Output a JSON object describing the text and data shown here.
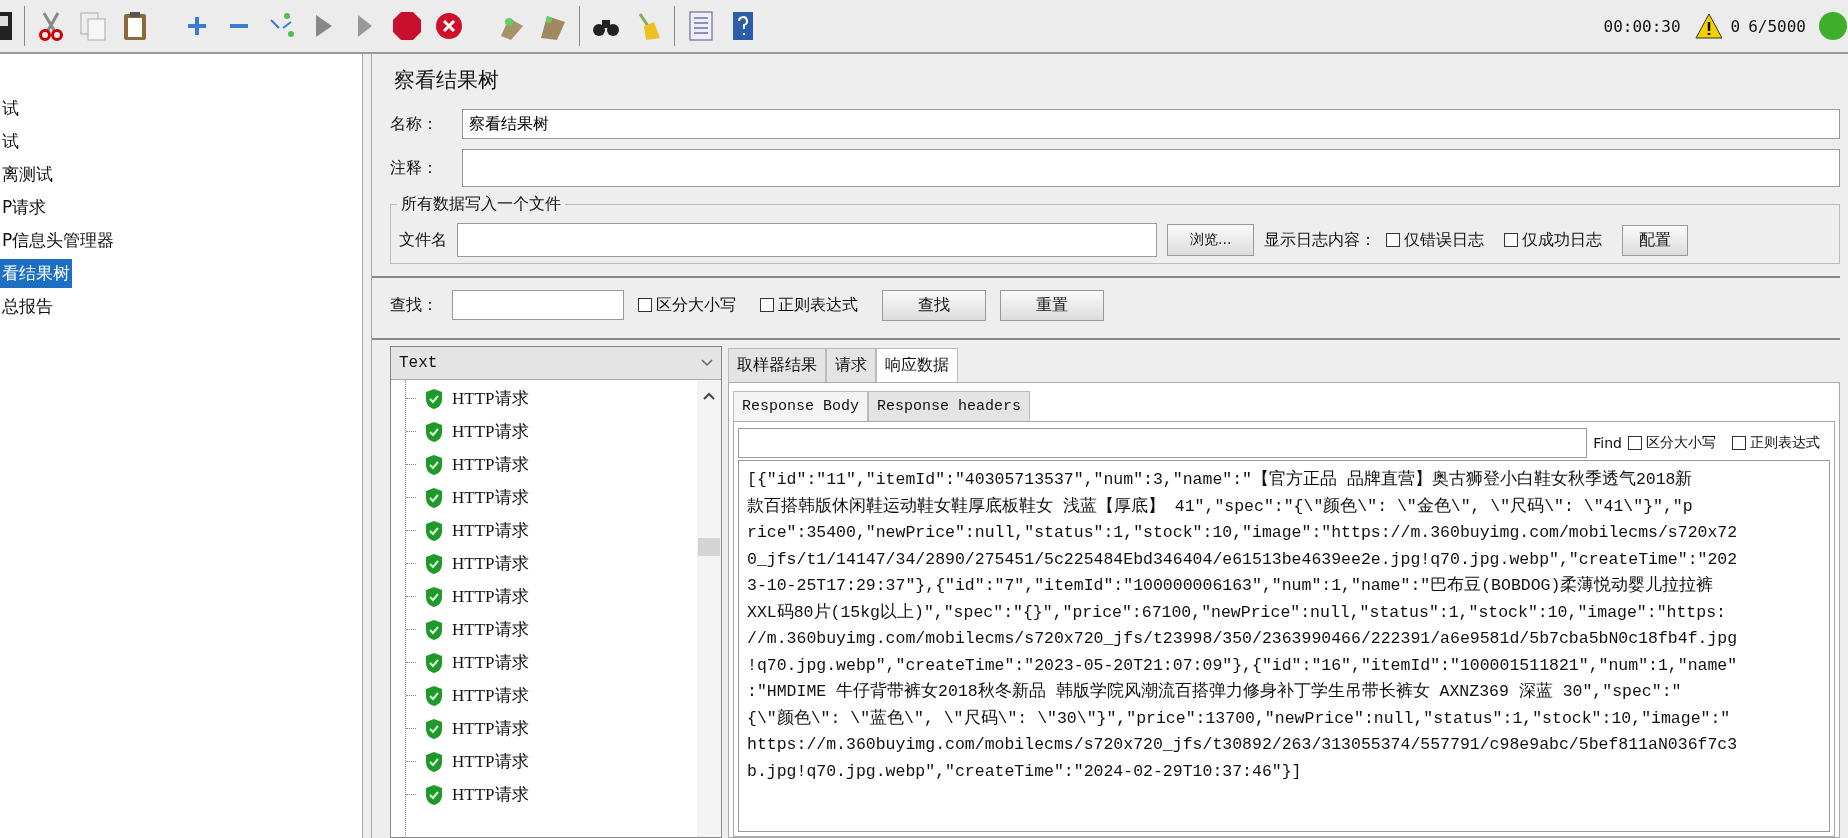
{
  "toolbar": {
    "elapsed": "00:00:30",
    "warnings": "0",
    "threads": "6/5000"
  },
  "tree": {
    "items": [
      {
        "label": "试",
        "selected": false
      },
      {
        "label": "试",
        "selected": false
      },
      {
        "label": "离测试",
        "selected": false
      },
      {
        "label": "P请求",
        "selected": false
      },
      {
        "label": "P信息头管理器",
        "selected": false
      },
      {
        "label": "看结果树",
        "selected": true
      },
      {
        "label": "总报告",
        "selected": false
      }
    ]
  },
  "panel": {
    "title": "察看结果树",
    "name_label": "名称：",
    "name_value": "察看结果树",
    "comment_label": "注释：",
    "file_group": {
      "legend": "所有数据写入一个文件",
      "file_label": "文件名",
      "browse": "浏览...",
      "log_label": "显示日志内容：",
      "checkboxes": [
        {
          "label": "仅错误日志",
          "checked": false
        },
        {
          "label": "仅成功日志",
          "checked": false
        }
      ],
      "config": "配置"
    },
    "search": {
      "label": "查找：",
      "checkboxes": [
        {
          "label": "区分大小写",
          "checked": false
        },
        {
          "label": "正则表达式",
          "checked": false
        }
      ],
      "buttons": [
        "查找",
        "重置"
      ]
    }
  },
  "results": {
    "renderer": "Text",
    "items": [
      "HTTP请求",
      "HTTP请求",
      "HTTP请求",
      "HTTP请求",
      "HTTP请求",
      "HTTP请求",
      "HTTP请求",
      "HTTP请求",
      "HTTP请求",
      "HTTP请求",
      "HTTP请求",
      "HTTP请求",
      "HTTP请求"
    ]
  },
  "tabs": [
    {
      "label": "取样器结果",
      "selected": false
    },
    {
      "label": "请求",
      "selected": false
    },
    {
      "label": "响应数据",
      "selected": true
    }
  ],
  "subtabs": [
    {
      "label": "Response Body",
      "selected": true
    },
    {
      "label": "Response headers",
      "selected": false
    }
  ],
  "find": {
    "label": "Find",
    "checkboxes": [
      {
        "label": "区分大小写",
        "checked": false
      },
      {
        "label": "正则表达式",
        "checked": false
      }
    ]
  },
  "body_lines": [
    "[{\"id\":\"11\",\"itemId\":\"40305713537\",\"num\":3,\"name\":\"【官方正品 品牌直营】奥古狮登小白鞋女秋季透气2018新",
    "款百搭韩版休闲鞋运动鞋女鞋厚底板鞋女 浅蓝【厚底】 41\",\"spec\":\"{\\\"颜色\\\": \\\"金色\\\", \\\"尺码\\\": \\\"41\\\"}\",\"p",
    "rice\":35400,\"newPrice\":null,\"status\":1,\"stock\":10,\"image\":\"https://m.360buyimg.com/mobilecms/s720x72",
    "0_jfs/t1/14147/34/2890/275451/5c225484Ebd346404/e61513be4639ee2e.jpg!q70.jpg.webp\",\"createTime\":\"202",
    "3-10-25T17:29:37\"},{\"id\":\"7\",\"itemId\":\"100000006163\",\"num\":1,\"name\":\"巴布豆(BOBDOG)柔薄悦动婴儿拉拉裤",
    "XXL码80片(15kg以上)\",\"spec\":\"{}\",\"price\":67100,\"newPrice\":null,\"status\":1,\"stock\":10,\"image\":\"https:",
    "//m.360buyimg.com/mobilecms/s720x720_jfs/t23998/350/2363990466/222391/a6e9581d/5b7cba5bN0c18fb4f.jpg",
    "!q70.jpg.webp\",\"createTime\":\"2023-05-20T21:07:09\"},{\"id\":\"16\",\"itemId\":\"100001511821\",\"num\":1,\"name\"",
    ":\"HMDIME 牛仔背带裤女2018秋冬新品 韩版学院风潮流百搭弹力修身补丁学生吊带长裤女 AXNZ369 深蓝 30\",\"spec\":\"",
    "{\\\"颜色\\\": \\\"蓝色\\\", \\\"尺码\\\": \\\"30\\\"}\",\"price\":13700,\"newPrice\":null,\"status\":1,\"stock\":10,\"image\":\"",
    "https://m.360buyimg.com/mobilecms/s720x720_jfs/t30892/263/313055374/557791/c98e9abc/5bef811aN036f7c3",
    "b.jpg!q70.jpg.webp\",\"createTime\":\"2024-02-29T10:37:46\"}]"
  ]
}
